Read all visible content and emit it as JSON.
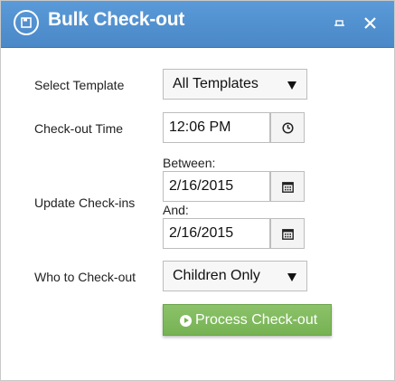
{
  "window": {
    "title": "Bulk Check-out",
    "icon": "checkout-icon",
    "controls": [
      "minimize-icon",
      "close-icon"
    ],
    "titlebar_color": "#4f8fd0"
  },
  "form": {
    "select_template": {
      "label": "Select Template",
      "value": "All Templates"
    },
    "checkout_time": {
      "label": "Check-out Time",
      "value": "12:06 PM",
      "icon": "clock-icon"
    },
    "update_checkins": {
      "label": "Update Check-ins",
      "between_label": "Between:",
      "between_value": "2/16/2015",
      "and_label": "And:",
      "and_value": "2/16/2015",
      "icon": "calendar-icon"
    },
    "who_to_checkout": {
      "label": "Who to Check-out",
      "value": "Children Only"
    }
  },
  "actions": {
    "process_label": "Process Check-out",
    "process_color": "#7ab656"
  }
}
